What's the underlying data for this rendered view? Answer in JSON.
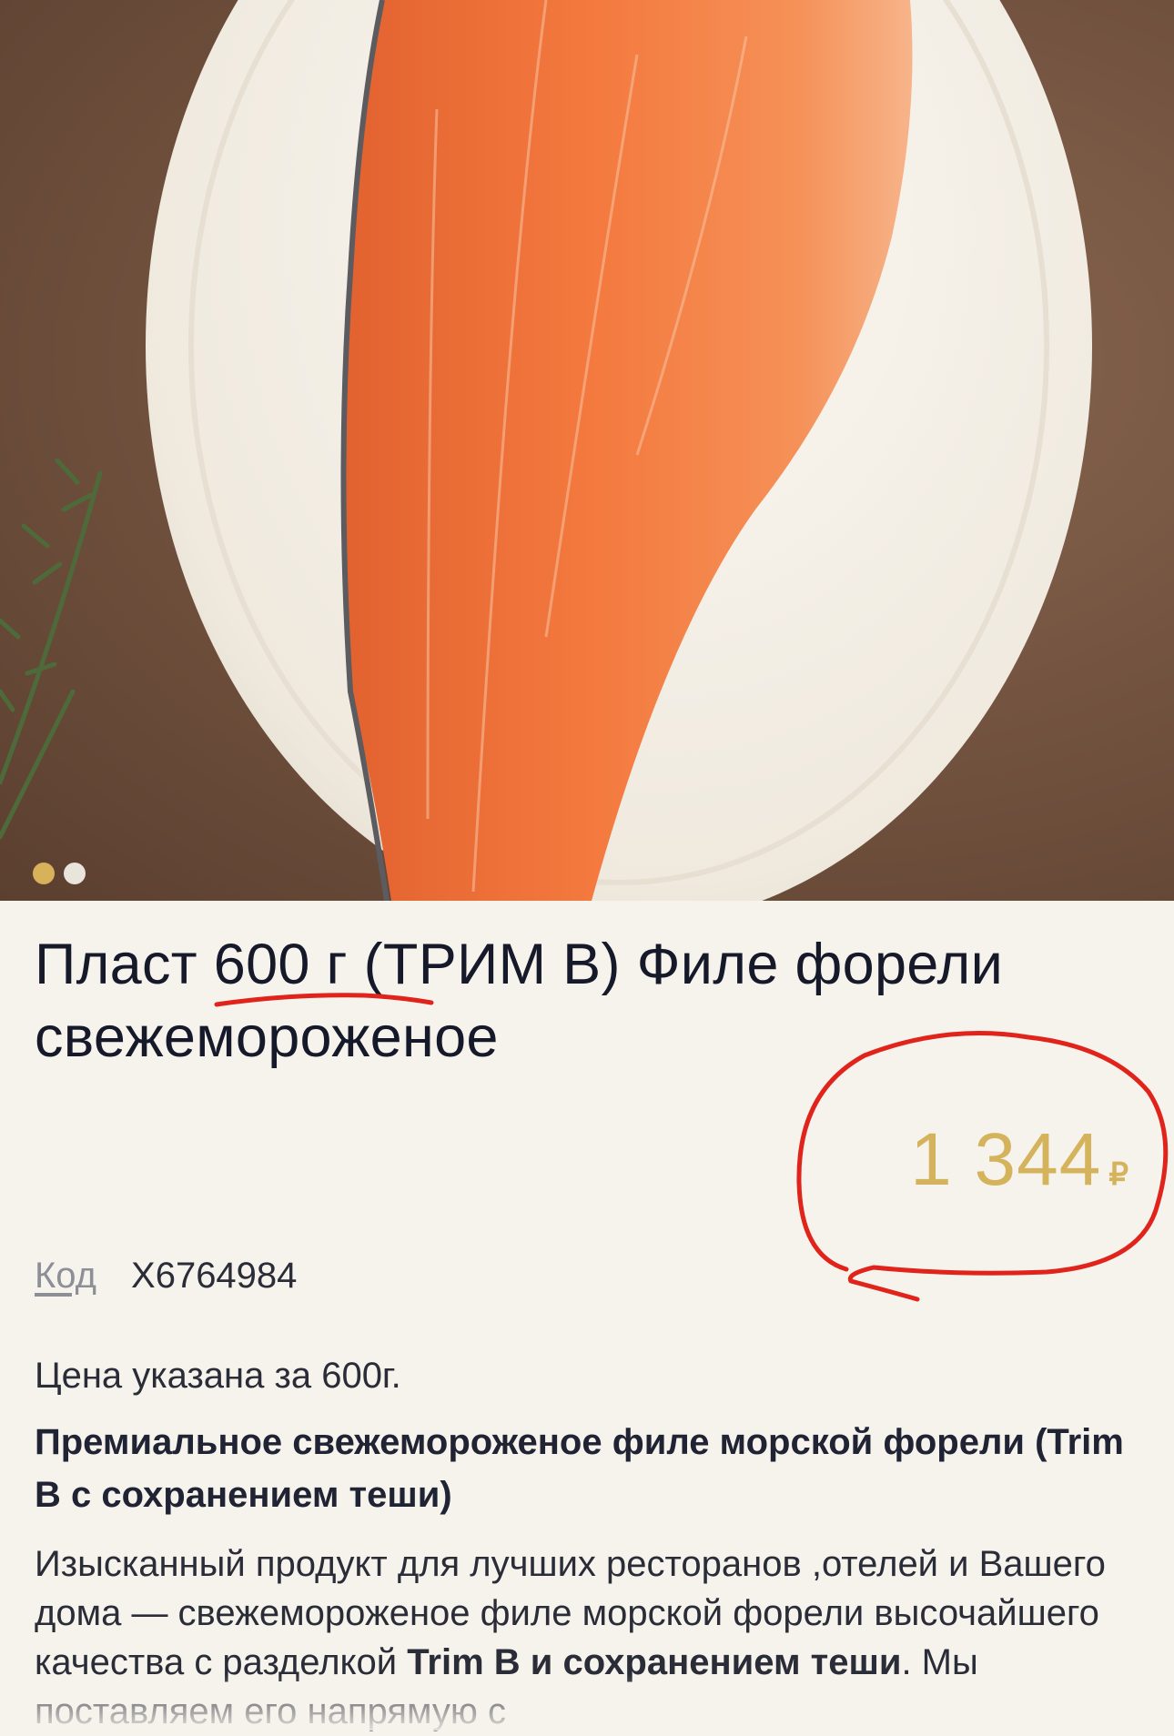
{
  "gallery": {
    "slide_count": 2,
    "active_slide": 1
  },
  "product": {
    "title": "Пласт 600 г (ТРИМ В) Филе форели свежемороженое",
    "price_amount": "1 344",
    "price_currency": "₽",
    "code_label": "Код",
    "code_value": "X6764984",
    "price_note": "Цена указана за 600г.",
    "subheading": "Премиальное свежемороженое филе морской форели (Trim B с сохранением теши)",
    "description_part1": "Изысканный продукт для лучших ресторанов ,отелей и Вашего дома — свежемороженое филе морской форели высочайшего качества с разделкой ",
    "description_bold": "Trim B и сохранением теши",
    "description_part2": ". Мы поставляем его напрямую с"
  },
  "colors": {
    "accent_price": "#d4b35c",
    "annotation_red": "#e0241c",
    "background": "#f6f3ec"
  }
}
